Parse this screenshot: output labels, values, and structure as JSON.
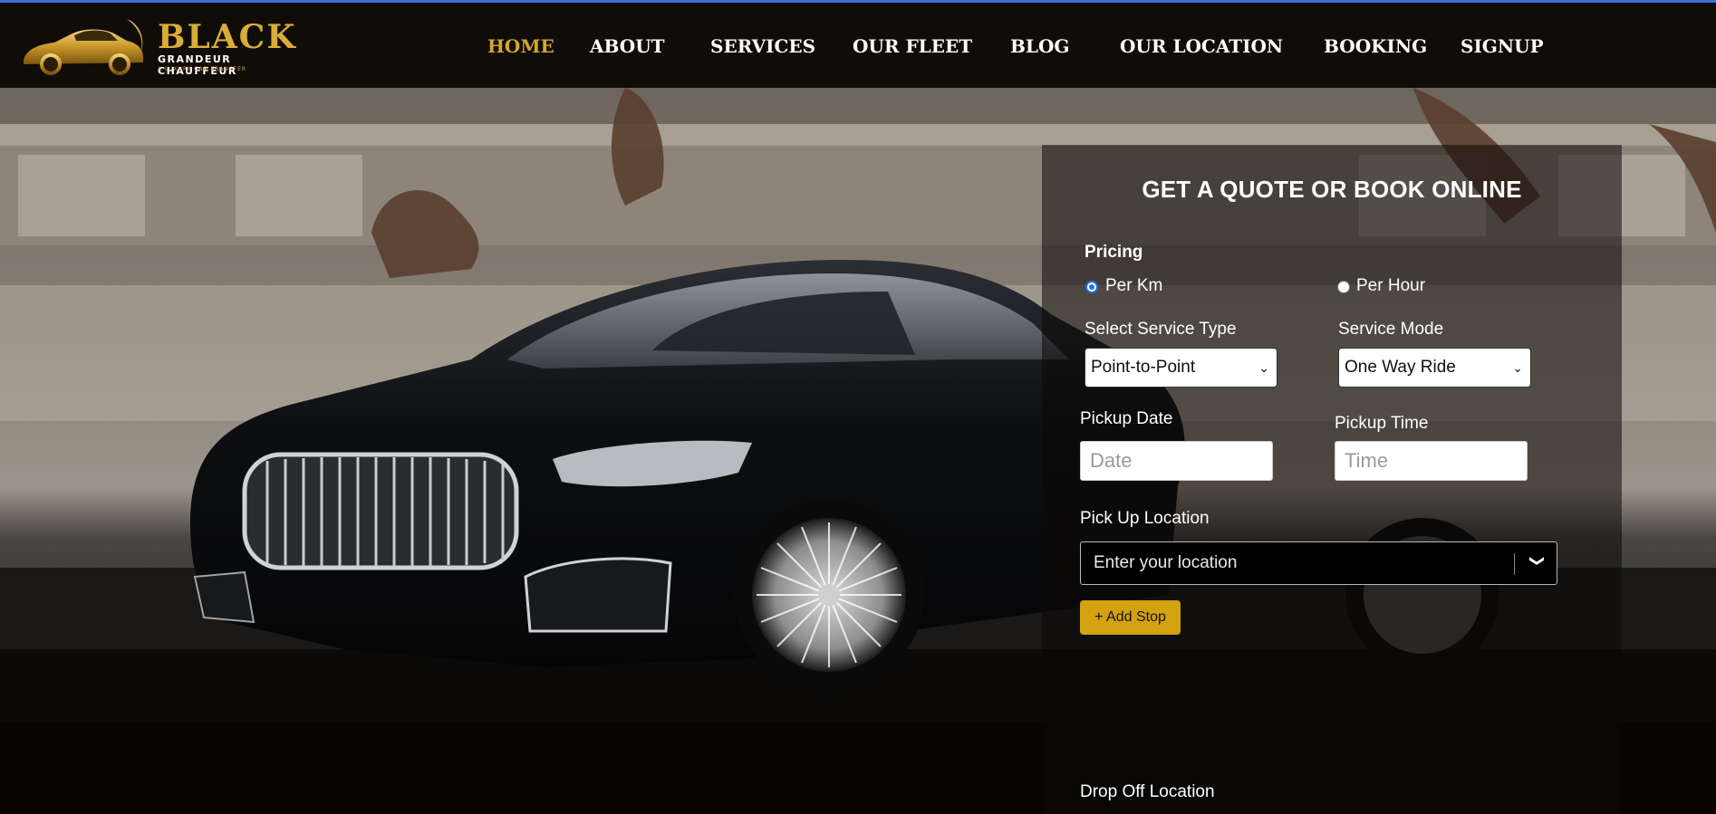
{
  "brand": {
    "name": "BLACK",
    "subtitle": "GRANDEUR CHAUFFEUR",
    "tagline": "A LUXURY CAR TRANSFER"
  },
  "nav": {
    "items": [
      {
        "label": "HOME",
        "active": true
      },
      {
        "label": "ABOUT",
        "active": false
      },
      {
        "label": "SERVICES",
        "active": false
      },
      {
        "label": "OUR FLEET",
        "active": false
      },
      {
        "label": "BLOG",
        "active": false
      },
      {
        "label": "OUR LOCATION",
        "active": false
      },
      {
        "label": "BOOKING",
        "active": false
      },
      {
        "label": "SIGNUP",
        "active": false
      }
    ]
  },
  "form": {
    "title": "GET A QUOTE OR BOOK ONLINE",
    "pricing_label": "Pricing",
    "pricing_options": [
      {
        "label": "Per Km",
        "checked": true
      },
      {
        "label": "Per Hour",
        "checked": false
      }
    ],
    "service_type_label": "Select Service Type",
    "service_type_value": "Point-to-Point",
    "service_mode_label": "Service Mode",
    "service_mode_value": "One Way Ride",
    "pickup_date_label": "Pickup Date",
    "pickup_date_placeholder": "Date",
    "pickup_time_label": "Pickup Time",
    "pickup_time_placeholder": "Time",
    "pickup_location_label": "Pick Up Location",
    "pickup_location_placeholder": "Enter your location",
    "add_stop_label": "+ Add Stop",
    "dropoff_location_label": "Drop Off Location"
  },
  "colors": {
    "accent_gold": "#d4a72c",
    "nav_background": "#100c08",
    "top_border": "#3a6fd6",
    "add_stop_button": "#d4a210"
  },
  "icons": {
    "chevron": "chevron-down-icon",
    "logo": "car-logo-icon"
  }
}
